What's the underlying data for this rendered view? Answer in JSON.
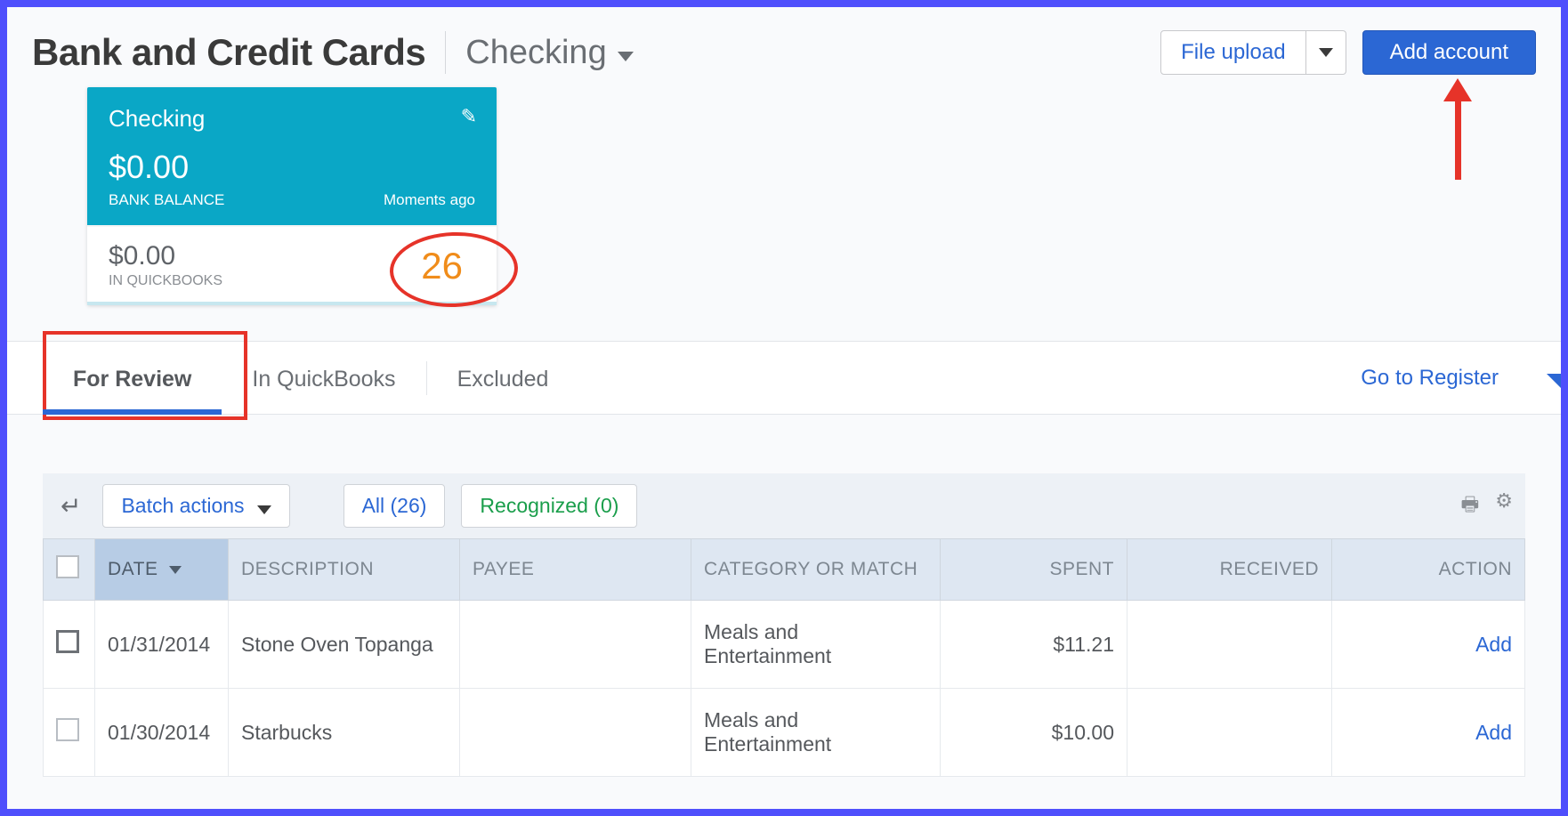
{
  "header": {
    "title": "Bank and Credit Cards",
    "account_name": "Checking",
    "file_upload_label": "File upload",
    "add_account_label": "Add account"
  },
  "tile": {
    "name": "Checking",
    "bank_balance": "$0.00",
    "bank_balance_label": "BANK BALANCE",
    "updated": "Moments ago",
    "qb_balance": "$0.00",
    "qb_balance_label": "IN QUICKBOOKS",
    "review_count": "26"
  },
  "tabs": {
    "for_review": "For Review",
    "in_quickbooks": "In QuickBooks",
    "excluded": "Excluded",
    "go_register": "Go to Register"
  },
  "toolbar": {
    "batch_actions": "Batch actions",
    "all_filter": "All (26)",
    "recognized_filter": "Recognized (0)"
  },
  "columns": {
    "date": "DATE",
    "description": "DESCRIPTION",
    "payee": "PAYEE",
    "category": "CATEGORY OR MATCH",
    "spent": "SPENT",
    "received": "RECEIVED",
    "action": "ACTION"
  },
  "rows": [
    {
      "date": "01/31/2014",
      "description": "Stone Oven Topanga",
      "payee": "",
      "category": "Meals and Entertainment",
      "spent": "$11.21",
      "received": "",
      "action": "Add"
    },
    {
      "date": "01/30/2014",
      "description": "Starbucks",
      "payee": "",
      "category": "Meals and Entertainment",
      "spent": "$10.00",
      "received": "",
      "action": "Add"
    }
  ]
}
